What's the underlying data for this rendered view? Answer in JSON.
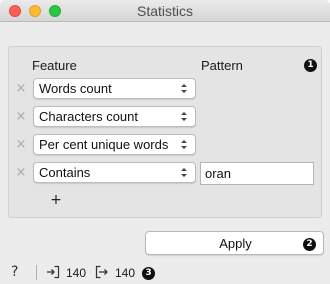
{
  "window": {
    "title": "Statistics"
  },
  "table": {
    "feature_header": "Feature",
    "pattern_header": "Pattern",
    "rows": [
      {
        "feature": "Words count",
        "pattern": ""
      },
      {
        "feature": "Characters count",
        "pattern": ""
      },
      {
        "feature": "Per cent unique words",
        "pattern": ""
      },
      {
        "feature": "Contains",
        "pattern": "oran"
      }
    ],
    "remove_glyph": "×",
    "add_glyph": "+"
  },
  "apply_label": "Apply",
  "status": {
    "help_glyph": "?",
    "input_count": "140",
    "output_count": "140"
  },
  "badges": [
    "1",
    "2",
    "3"
  ],
  "icons": {
    "dropdown": "chevron-updown-icon",
    "remove": "close-icon",
    "add": "plus-icon",
    "help": "question-icon",
    "input": "input-data-icon",
    "output": "output-data-icon"
  },
  "colors": {
    "window_bg": "#ececec",
    "close": "#fc5f57",
    "minimize": "#fdbc2e",
    "maximize": "#28c840",
    "badge": "#111111"
  }
}
